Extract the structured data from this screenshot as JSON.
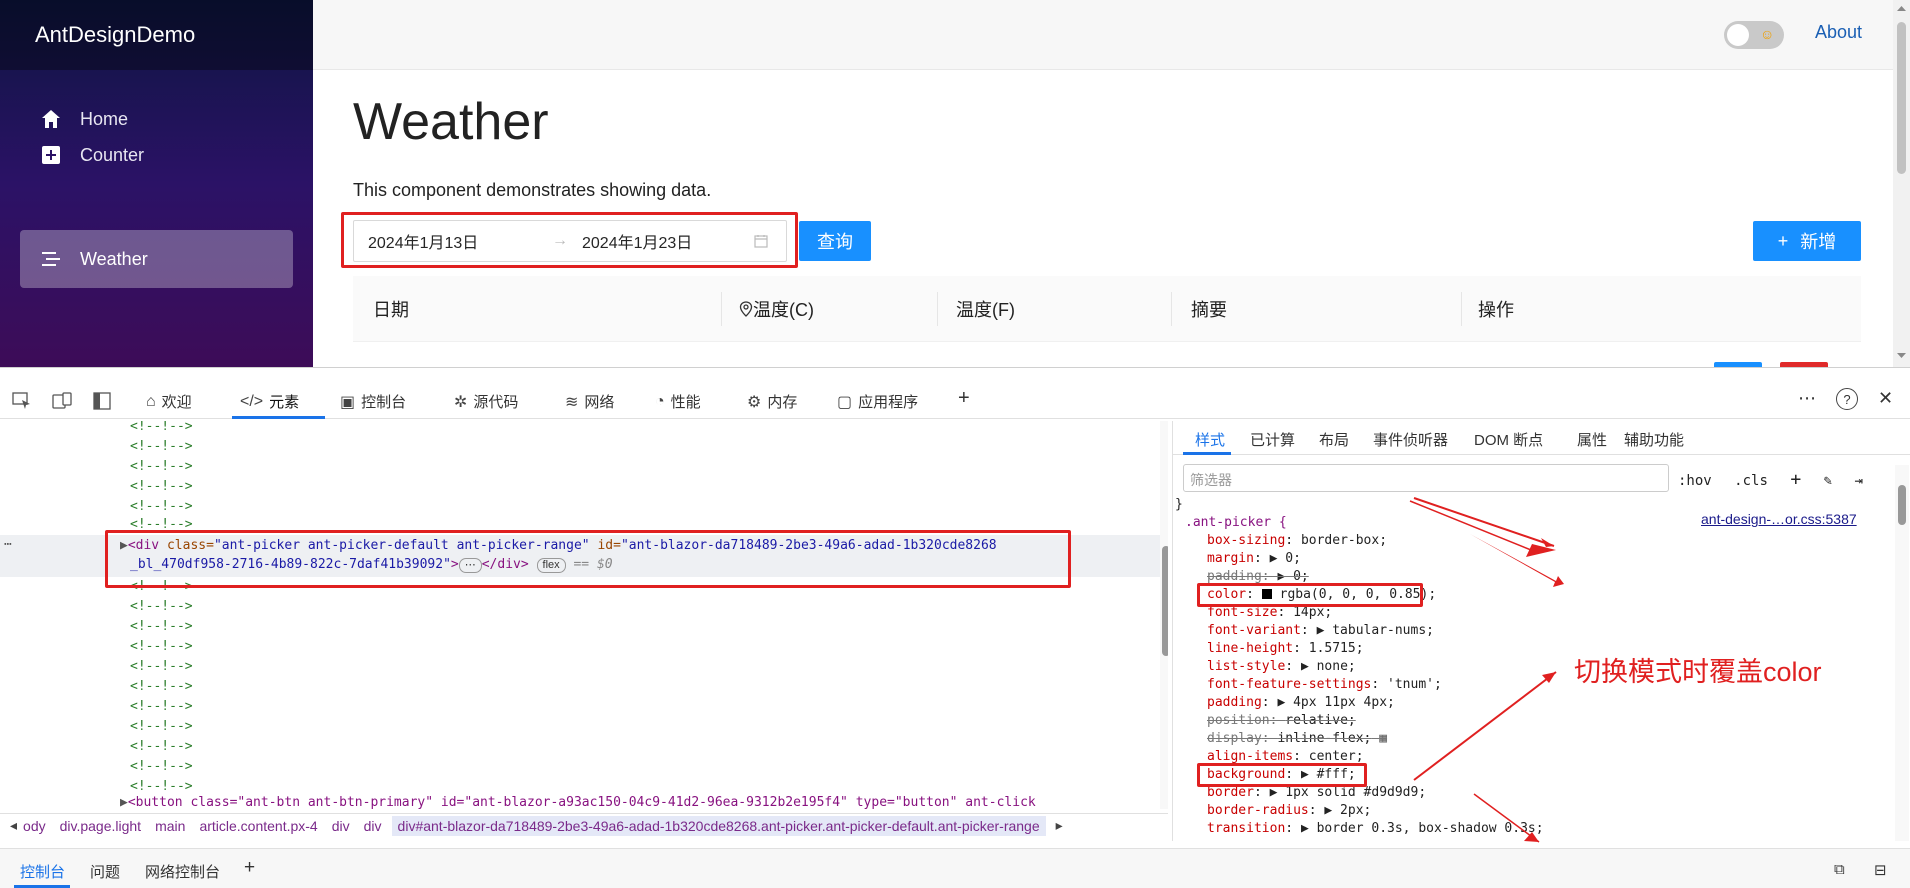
{
  "app": {
    "brand": "AntDesignDemo",
    "nav": [
      {
        "label": "Home",
        "icon": "home-icon"
      },
      {
        "label": "Counter",
        "icon": "plus-square-icon"
      },
      {
        "label": "Weather",
        "icon": "menu-icon",
        "active": true
      }
    ],
    "about_label": "About",
    "theme_toggle": {
      "state": "off",
      "icon": "sun-face-icon"
    },
    "page_title": "Weather",
    "description": "This component demonstrates showing data.",
    "date_range": {
      "start": "2024年1月13日",
      "end": "2024年1月23日",
      "separator": "→"
    },
    "query_button": "查询",
    "add_button": "新增",
    "add_icon": "+",
    "table_headers": [
      "日期",
      "温度(C)",
      "温度(F)",
      "摘要",
      "操作"
    ]
  },
  "devtools": {
    "toolbar_tabs": [
      "欢迎",
      "元素",
      "控制台",
      "源代码",
      "网络",
      "性能",
      "内存",
      "应用程序"
    ],
    "active_tab": "元素",
    "add_tab": "+",
    "more": "⋯",
    "help": "?",
    "close": "✕",
    "comment": "<!--!-->",
    "dots": "⋯",
    "selected_node": {
      "line1_open": "<div ",
      "class_attr": "class=",
      "class_val": "\"ant-picker ant-picker-default ant-picker-range\"",
      "id_attr": " id=",
      "id_val": "\"ant-blazor-da718489-2be3-49a6-adad-1b320cde8268",
      "id_val_cont": "_bl_470df958-2716-4b89-822c-7daf41b39092\"",
      "close": ">",
      "ellipsis": "⋯",
      "end_tag": "</div>",
      "badge": "flex",
      "eq": "== $0"
    },
    "next_node": "<button class=\"ant-btn ant-btn-primary\" id=\"ant-blazor-a93ac150-04c9-41d2-96ea-9312b2e195f4\" type=\"button\" ant-click",
    "breadcrumb": [
      "ody",
      "div.page.light",
      "main",
      "article.content.px-4",
      "div",
      "div",
      "div#ant-blazor-da718489-2be3-49a6-adad-1b320cde8268.ant-picker.ant-picker-default.ant-picker-range"
    ],
    "styles_tabs": [
      "样式",
      "已计算",
      "布局",
      "事件侦听器",
      "DOM 断点",
      "属性",
      "辅助功能"
    ],
    "filter_placeholder": "筛选器",
    "hov": ":hov",
    "cls": ".cls",
    "brace_close": "}",
    "rule_selector": ".ant-picker {",
    "rule_source": "ant-design-…or.css:5387",
    "declarations": [
      {
        "prop": "box-sizing",
        "value": "border-box;"
      },
      {
        "prop": "margin",
        "value": "▶ 0;"
      },
      {
        "prop": "padding",
        "value": "▶ 0;"
      },
      {
        "prop": "color",
        "value": "rgba(0, 0, 0, 0.85);"
      },
      {
        "prop": "font-size",
        "value": "14px;"
      },
      {
        "prop": "font-variant",
        "value": "▶ tabular-nums;"
      },
      {
        "prop": "line-height",
        "value": "1.5715;"
      },
      {
        "prop": "list-style",
        "value": "▶ none;"
      },
      {
        "prop": "font-feature-settings",
        "value": "'tnum';"
      },
      {
        "prop": "padding",
        "value": "▶ 4px 11px 4px;"
      },
      {
        "prop": "position",
        "value": "relative;"
      },
      {
        "prop": "display",
        "value": "inline-flex;"
      },
      {
        "prop": "align-items",
        "value": "center;"
      },
      {
        "prop": "background",
        "value": "▶ #fff;"
      },
      {
        "prop": "border",
        "value": "▶ 1px solid  #d9d9d9;"
      },
      {
        "prop": "border-radius",
        "value": "▶ 2px;"
      },
      {
        "prop": "transition",
        "value": "▶ border 0.3s, box-shadow 0.3s;"
      }
    ],
    "annotation": "切换模式时覆盖color",
    "drawer_tabs": [
      "控制台",
      "问题",
      "网络控制台"
    ],
    "drawer_add": "+"
  },
  "colors": {
    "primary": "#1890ff",
    "danger": "#e02a2a",
    "annotation": "#e02020",
    "devtools_accent": "#1a73e8"
  }
}
